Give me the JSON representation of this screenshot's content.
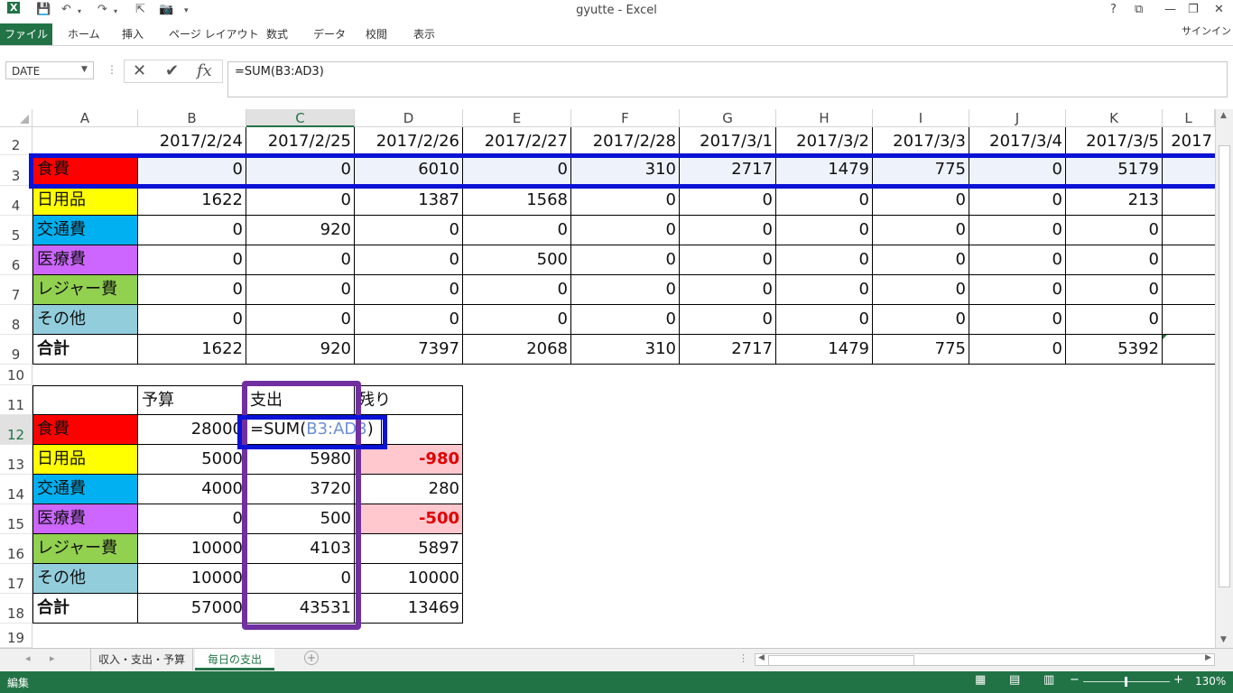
{
  "app": {
    "title": "gyutte - Excel",
    "signin": "サインイン",
    "help": "?",
    "ribbon_tabs": [
      "ファイル",
      "ホーム",
      "挿入",
      "ページ レイアウト",
      "数式",
      "データ",
      "校閲",
      "表示"
    ]
  },
  "formula_bar": {
    "name_box": "DATE",
    "formula": "=SUM(B3:AD3)"
  },
  "columns": [
    "A",
    "B",
    "C",
    "D",
    "E",
    "F",
    "G",
    "H",
    "I",
    "J",
    "K",
    "L"
  ],
  "rows": [
    "2",
    "3",
    "4",
    "5",
    "6",
    "7",
    "8",
    "9",
    "10",
    "11",
    "12",
    "13",
    "14",
    "15",
    "16",
    "17",
    "18",
    "19"
  ],
  "daily": {
    "dates": [
      "2017/2/24",
      "2017/2/25",
      "2017/2/26",
      "2017/2/27",
      "2017/2/28",
      "2017/3/1",
      "2017/3/2",
      "2017/3/3",
      "2017/3/4",
      "2017/3/5",
      "2017"
    ],
    "categories": [
      {
        "label": "食費",
        "color": "#ff0000",
        "values": [
          "0",
          "0",
          "6010",
          "0",
          "310",
          "2717",
          "1479",
          "775",
          "0",
          "5179"
        ]
      },
      {
        "label": "日用品",
        "color": "#ffff00",
        "values": [
          "1622",
          "0",
          "1387",
          "1568",
          "0",
          "0",
          "0",
          "0",
          "0",
          "213"
        ]
      },
      {
        "label": "交通費",
        "color": "#00b0f0",
        "values": [
          "0",
          "920",
          "0",
          "0",
          "0",
          "0",
          "0",
          "0",
          "0",
          "0"
        ]
      },
      {
        "label": "医療費",
        "color": "#cc66ff",
        "values": [
          "0",
          "0",
          "0",
          "500",
          "0",
          "0",
          "0",
          "0",
          "0",
          "0"
        ]
      },
      {
        "label": "レジャー費",
        "color": "#92d050",
        "values": [
          "0",
          "0",
          "0",
          "0",
          "0",
          "0",
          "0",
          "0",
          "0",
          "0"
        ]
      },
      {
        "label": "その他",
        "color": "#92cddc",
        "values": [
          "0",
          "0",
          "0",
          "0",
          "0",
          "0",
          "0",
          "0",
          "0",
          "0"
        ]
      }
    ],
    "total": {
      "label": "合計",
      "values": [
        "1622",
        "920",
        "7397",
        "2068",
        "310",
        "2717",
        "1479",
        "775",
        "0",
        "5392"
      ]
    }
  },
  "summary": {
    "headers": [
      "予算",
      "支出",
      "残り"
    ],
    "rows": [
      {
        "label": "食費",
        "color": "#ff0000",
        "budget": "28000",
        "spent": "=SUM(",
        "spent_ref": "B3:AD3",
        "spent_close": ")",
        "remain": ""
      },
      {
        "label": "日用品",
        "color": "#ffff00",
        "budget": "5000",
        "spent": "5980",
        "remain": "-980",
        "negative": true
      },
      {
        "label": "交通費",
        "color": "#00b0f0",
        "budget": "4000",
        "spent": "3720",
        "remain": "280"
      },
      {
        "label": "医療費",
        "color": "#cc66ff",
        "budget": "0",
        "spent": "500",
        "remain": "-500",
        "negative": true
      },
      {
        "label": "レジャー費",
        "color": "#92d050",
        "budget": "10000",
        "spent": "4103",
        "remain": "5897"
      },
      {
        "label": "その他",
        "color": "#92cddc",
        "budget": "10000",
        "spent": "0",
        "remain": "10000"
      },
      {
        "label": "合計",
        "budget": "57000",
        "spent": "43531",
        "remain": "13469",
        "bold": true
      }
    ]
  },
  "sheet_tabs": [
    "収入・支出・予算",
    "毎日の支出"
  ],
  "active_sheet": "毎日の支出",
  "status": {
    "mode": "編集",
    "zoom": "130%"
  }
}
